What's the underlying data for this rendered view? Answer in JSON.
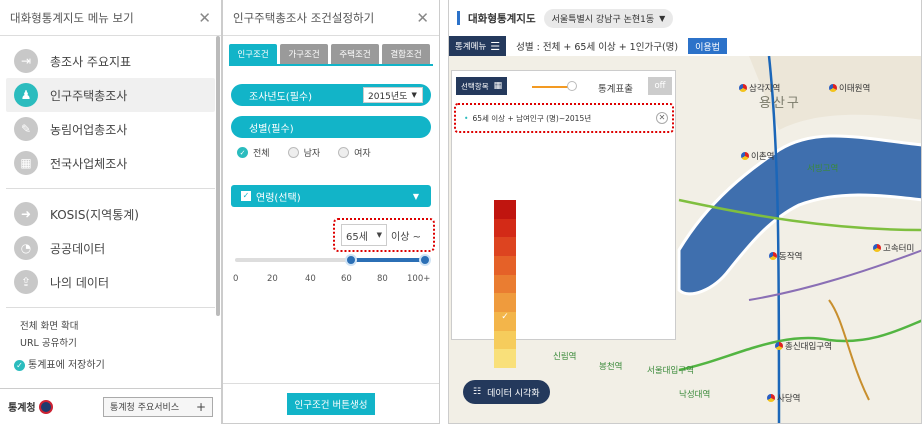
{
  "left_menu": {
    "title": "대화형통계지도 메뉴 보기",
    "items": [
      {
        "label": "총조사 주요지표",
        "icon": "signpost-icon"
      },
      {
        "label": "인구주택총조사",
        "icon": "people-icon",
        "active": true
      },
      {
        "label": "농림어업총조사",
        "icon": "crop-icon"
      },
      {
        "label": "전국사업체조사",
        "icon": "building-icon"
      }
    ],
    "items2": [
      {
        "label": "KOSIS(지역통계)",
        "icon": "arrow-icon"
      },
      {
        "label": "공공데이터",
        "icon": "pie-icon"
      },
      {
        "label": "나의 데이터",
        "icon": "upload-icon"
      }
    ],
    "links": [
      "전체 화면 확대",
      "URL 공유하기"
    ],
    "overlap_text": "통계표에 저장하기",
    "footer_logo": "통계청",
    "footer_service": "통계청 주요서비스"
  },
  "cond": {
    "title": "인구주택총조사 조건설정하기",
    "tabs": [
      "인구조건",
      "가구조건",
      "주택조건",
      "결합조건"
    ],
    "year_label": "조사년도(필수)",
    "year_value": "2015년도",
    "gender_label": "성별(필수)",
    "gender_options": [
      "전체",
      "남자",
      "여자"
    ],
    "age_label": "연령(선택)",
    "age_value": "65세",
    "age_suffix": "이상 ~",
    "ticks": [
      "0",
      "20",
      "40",
      "60",
      "80",
      "100+"
    ],
    "age_range": [
      65,
      100
    ],
    "generate": "인구조건 버튼생성"
  },
  "map": {
    "title": "대화형통계지도",
    "region": "서울특별시 강남구 논현1동",
    "menu_label": "통계메뉴",
    "condition": "성별 : 전체 + 65세 이상 + 1인가구(명)",
    "use_btn": "이용법",
    "select_btn": "선택항목",
    "stat_label": "통계표출",
    "toggle": "off",
    "item": "65세 이상 + 남여인구 (명)~2015년",
    "viz_btn": "데이터 시각화",
    "district": "용산구",
    "legend_colors": [
      "#c0150f",
      "#d32a17",
      "#dd4420",
      "#e56128",
      "#ea7d31",
      "#ef9b3d",
      "#f3b54a",
      "#f6cc5c",
      "#f9e07a"
    ],
    "stations": [
      {
        "name": "삼각지역"
      },
      {
        "name": "이태원역"
      },
      {
        "name": "이촌역"
      },
      {
        "name": "서빙고역"
      },
      {
        "name": "동작역"
      },
      {
        "name": "고속터미"
      },
      {
        "name": "총신대입구역"
      },
      {
        "name": "사당역"
      },
      {
        "name": "신림역"
      },
      {
        "name": "봉천역"
      },
      {
        "name": "서울대입구역"
      },
      {
        "name": "낙성대역"
      }
    ]
  }
}
